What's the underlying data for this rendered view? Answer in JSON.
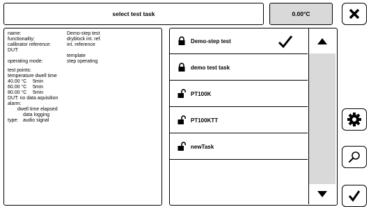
{
  "header": {
    "title": "select test task",
    "temperature": "0.00°C"
  },
  "buttons": {
    "close_icon": "close-icon",
    "settings_icon": "gear-icon",
    "search_icon": "search-icon",
    "confirm_icon": "checkmark-icon"
  },
  "info": {
    "name_label": "name:",
    "name_value": "Demo-step test",
    "functionality_label": "functionality:",
    "functionality_value": "dryblock int. ref.",
    "calref_label": "calibrator reference:",
    "calref_value": "int. reference",
    "dut_label": "DUT:",
    "dut_value": "template",
    "opmode_label": "operating mode:",
    "opmode_value": "step operating",
    "test_points_label": "test points:",
    "tp_header": "temperature dwell time",
    "test_points": [
      {
        "temperature": "40.00 °C",
        "dwell": "5min"
      },
      {
        "temperature": "60.00 °C",
        "dwell": "5min"
      },
      {
        "temperature": "80.00 °C",
        "dwell": "5min"
      }
    ],
    "dut_note": "DUT: no data aquisition",
    "alarm_label": "alarm:",
    "alarm_1": "dwell time elapsed",
    "alarm_2": "data logging",
    "type_label": "type:",
    "type_value": "audio signal"
  },
  "tasks": [
    {
      "label": "Demo-step test",
      "locked": true,
      "selected": true
    },
    {
      "label": "demo test task",
      "locked": true,
      "selected": false
    },
    {
      "label": "PT100K",
      "locked": false,
      "selected": false
    },
    {
      "label": "PT100KTT",
      "locked": false,
      "selected": false
    },
    {
      "label": "newTask",
      "locked": false,
      "selected": false
    }
  ],
  "colors": {
    "accent_gray": "#d9d9d9",
    "border": "#000000"
  }
}
